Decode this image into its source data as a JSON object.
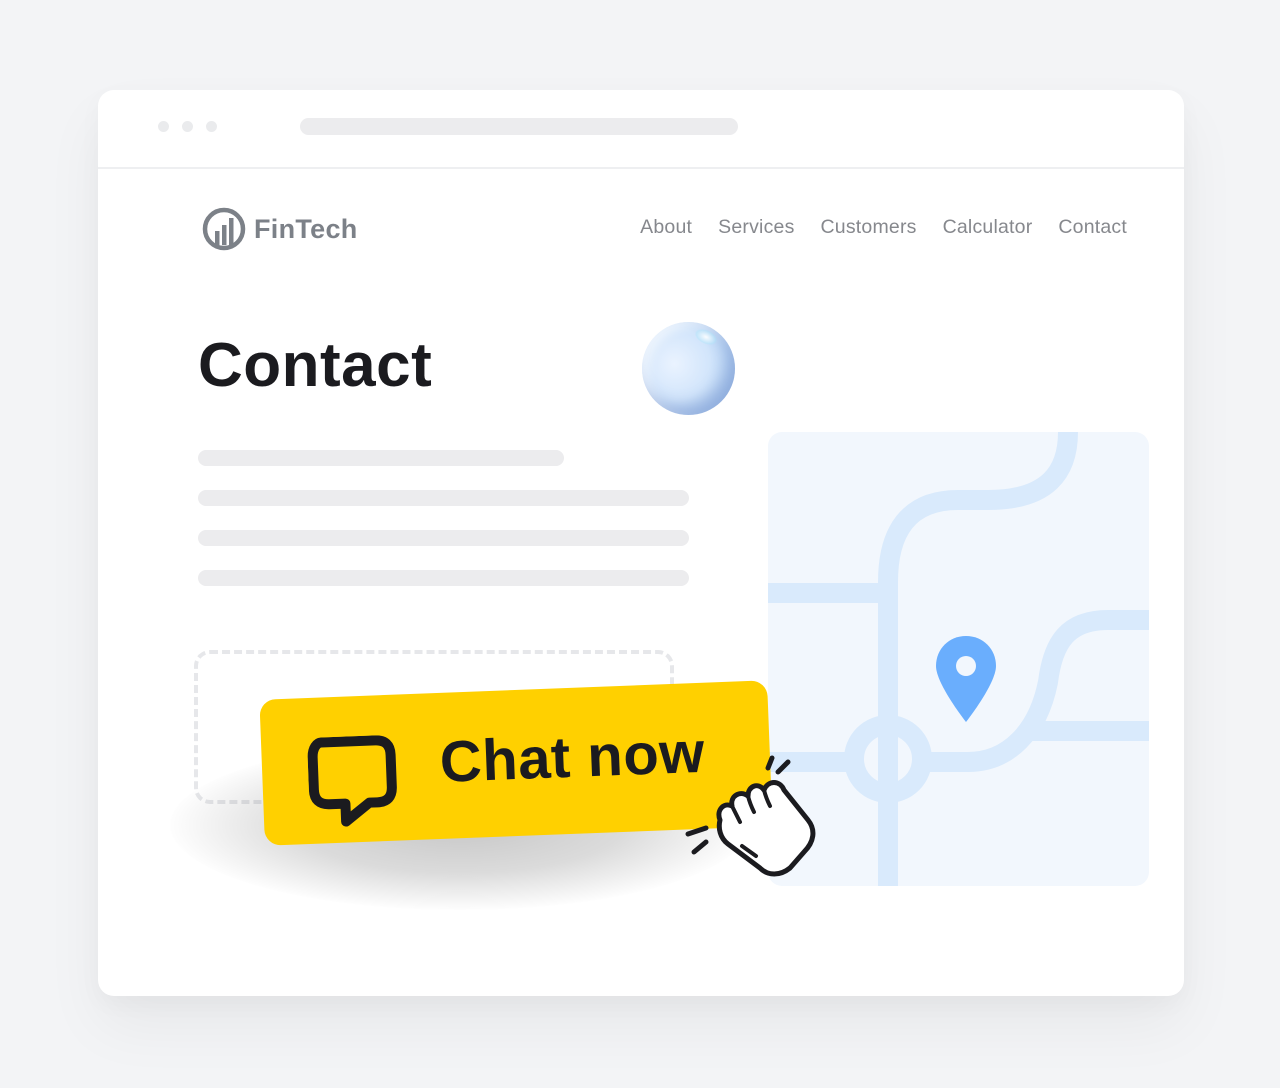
{
  "browser": {
    "window_controls": [
      "dot",
      "dot",
      "dot"
    ],
    "address_bar": ""
  },
  "header": {
    "logo_text": "FinTech",
    "logo_icon": "bar-chart-circle-icon",
    "nav": [
      {
        "label": "About"
      },
      {
        "label": "Services"
      },
      {
        "label": "Customers"
      },
      {
        "label": "Calculator"
      },
      {
        "label": "Contact"
      }
    ]
  },
  "main": {
    "title": "Contact",
    "text_placeholder_lines": 4,
    "cta": {
      "label": "Chat now",
      "icon": "chat-bubble-icon",
      "cursor_icon": "hand-click-icon",
      "color": "#ffd000"
    },
    "map": {
      "pin_icon": "location-pin-icon",
      "pin_color": "#6aaefd",
      "road_color": "#d9eafc",
      "background": "#f2f7fd"
    }
  }
}
